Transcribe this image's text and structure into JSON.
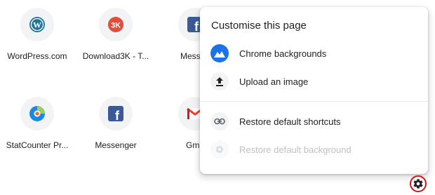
{
  "shortcuts": [
    {
      "label": "WordPress.com",
      "icon": "wordpress-icon"
    },
    {
      "label": "Download3K - T...",
      "icon": "download3k-icon"
    },
    {
      "label": "Messen",
      "icon": "facebook-icon"
    },
    {
      "label": "StatCounter Pr...",
      "icon": "statcounter-icon"
    },
    {
      "label": "Messenger",
      "icon": "facebook-icon"
    },
    {
      "label": "Gma",
      "icon": "gmail-icon"
    }
  ],
  "menu": {
    "title": "Customise this page",
    "items": [
      {
        "label": "Chrome backgrounds",
        "icon": "chrome-backgrounds-icon",
        "enabled": true
      },
      {
        "label": "Upload an image",
        "icon": "upload-icon",
        "enabled": true
      },
      {
        "label": "Restore default shortcuts",
        "icon": "link-icon",
        "enabled": true
      },
      {
        "label": "Restore default background",
        "icon": "restore-background-icon",
        "enabled": false
      }
    ]
  },
  "colors": {
    "accent": "#1a73e8",
    "highlight": "#e01010"
  },
  "settings_button": {
    "icon": "gear-icon"
  }
}
